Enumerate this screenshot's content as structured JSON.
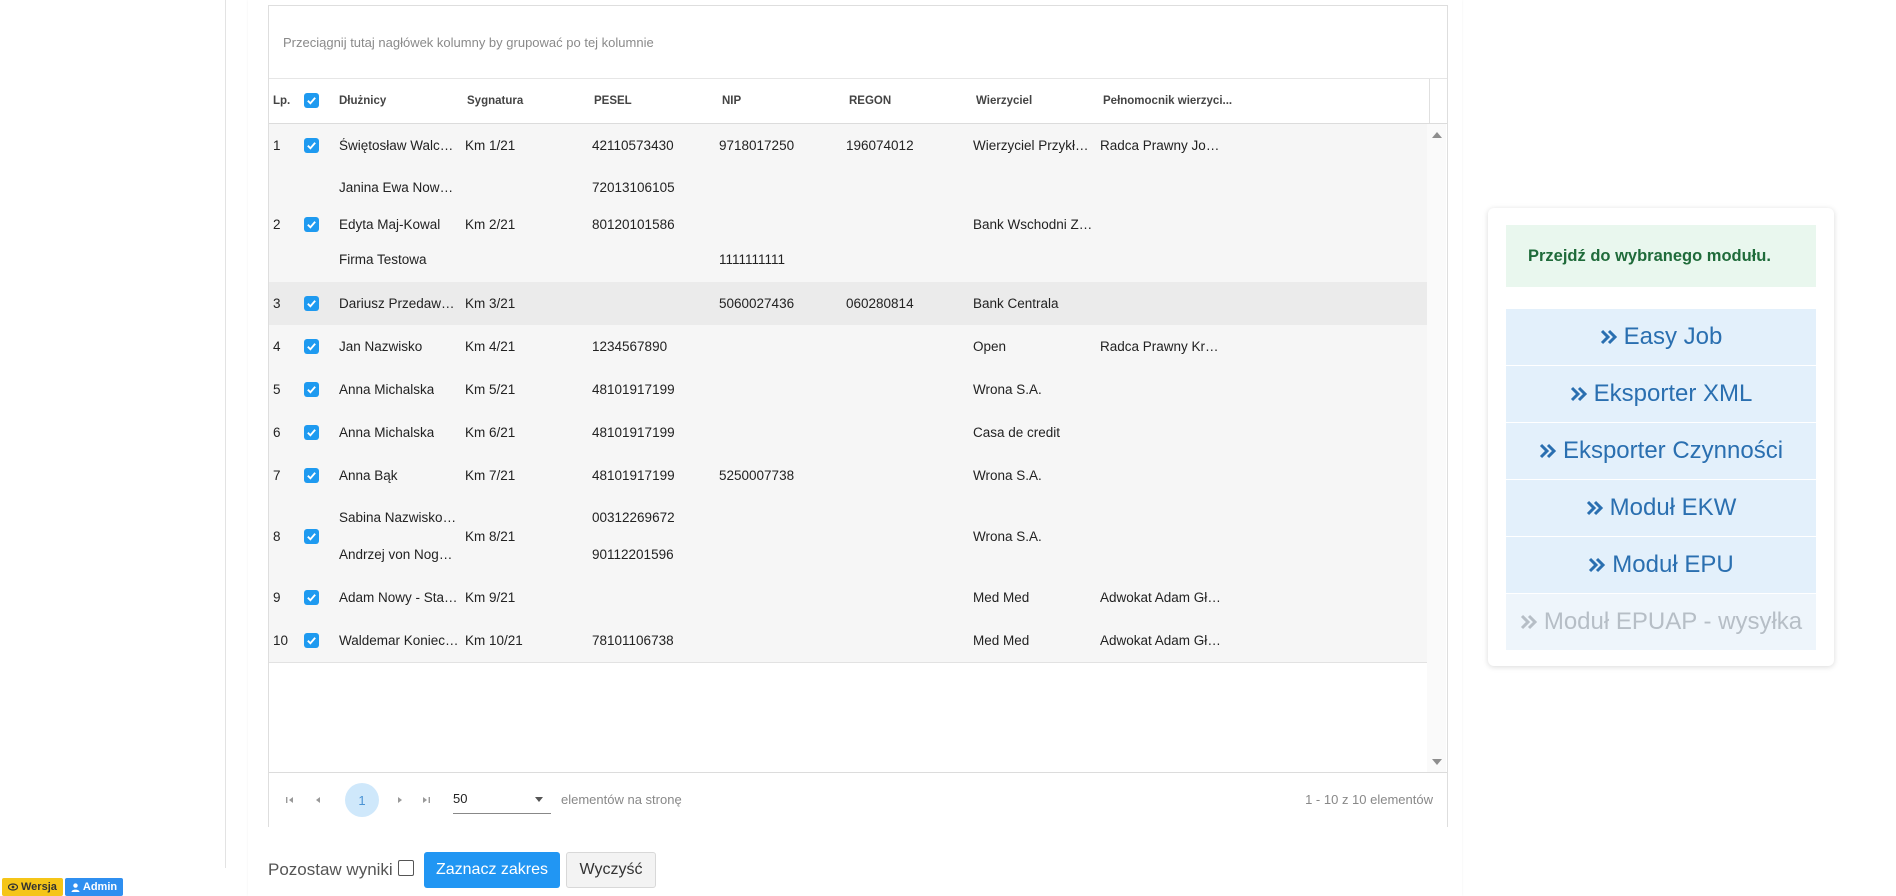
{
  "grid": {
    "group_hint": "Przeciągnij tutaj nagłówek kolumny by grupować po tej kolumnie",
    "columns": {
      "lp": "Lp.",
      "debtors": "Dłużnicy",
      "signature": "Sygnatura",
      "pesel": "PESEL",
      "nip": "NIP",
      "regon": "REGON",
      "creditor": "Wierzyciel",
      "attorney": "Pełnomocnik wierzyci..."
    },
    "rows": [
      {
        "lp": "1",
        "debtors": [
          "Świętosław Walczak"
        ],
        "signature": "Km 1/21",
        "pesel": [
          "42110573430"
        ],
        "nip": [
          "9718017250"
        ],
        "regon": "196074012",
        "creditor": "Wierzyciel Przykładow...",
        "attorney": "Radca Prawny Joann...",
        "checked": true
      },
      {
        "lp": "2",
        "debtors": [
          "Janina Ewa Nowak (d....",
          "Edyta Maj-Kowal",
          "Firma Testowa"
        ],
        "signature": "Km 2/21",
        "pesel": [
          "72013106105",
          "80120101586",
          ""
        ],
        "nip": [
          "",
          "",
          "1111111111"
        ],
        "regon": "",
        "creditor": "Bank Wschodni ZBK SA",
        "attorney": "",
        "checked": true
      },
      {
        "lp": "3",
        "debtors": [
          "Dariusz Przedawnienie"
        ],
        "signature": "Km 3/21",
        "pesel": [
          ""
        ],
        "nip": [
          "5060027436"
        ],
        "regon": "060280814",
        "creditor": "Bank Centrala",
        "attorney": "",
        "checked": true
      },
      {
        "lp": "4",
        "debtors": [
          "Jan Nazwisko"
        ],
        "signature": "Km 4/21",
        "pesel": [
          "1234567890"
        ],
        "nip": [
          ""
        ],
        "regon": "",
        "creditor": "Open",
        "attorney": "Radca Prawny Krzysz...",
        "checked": true
      },
      {
        "lp": "5",
        "debtors": [
          "Anna Michalska"
        ],
        "signature": "Km 5/21",
        "pesel": [
          "48101917199"
        ],
        "nip": [
          ""
        ],
        "regon": "",
        "creditor": "Wrona S.A.",
        "attorney": "",
        "checked": true
      },
      {
        "lp": "6",
        "debtors": [
          "Anna Michalska"
        ],
        "signature": "Km 6/21",
        "pesel": [
          "48101917199"
        ],
        "nip": [
          ""
        ],
        "regon": "",
        "creditor": "Casa de credit",
        "attorney": "",
        "checked": true
      },
      {
        "lp": "7",
        "debtors": [
          "Anna Bąk"
        ],
        "signature": "Km 7/21",
        "pesel": [
          "48101917199"
        ],
        "nip": [
          "5250007738"
        ],
        "regon": "",
        "creditor": "Wrona S.A.",
        "attorney": "",
        "checked": true
      },
      {
        "lp": "8",
        "debtors": [
          "Sabina Nazwiskowa d...",
          "Andrzej von Nogaj-Le..."
        ],
        "signature": "Km 8/21",
        "pesel": [
          "00312269672",
          "90112201596"
        ],
        "nip": [
          "",
          ""
        ],
        "regon": "",
        "creditor": "Wrona S.A.",
        "attorney": "",
        "checked": true
      },
      {
        "lp": "9",
        "debtors": [
          "Adam Nowy - Stary d. ..."
        ],
        "signature": "Km 9/21",
        "pesel": [
          ""
        ],
        "nip": [
          ""
        ],
        "regon": "",
        "creditor": "Med Med",
        "attorney": "Adwokat Adam Głowacki",
        "checked": true
      },
      {
        "lp": "10",
        "debtors": [
          "Waldemar Konieczny"
        ],
        "signature": "Km 10/21",
        "pesel": [
          "78101106738"
        ],
        "nip": [
          ""
        ],
        "regon": "",
        "creditor": "Med Med",
        "attorney": "Adwokat Adam Głowacki",
        "checked": true
      }
    ]
  },
  "pager": {
    "current_page": "1",
    "page_size": "50",
    "per_page_label": "elementów na stronę",
    "range_info": "1 - 10 z 10 elementów"
  },
  "actions": {
    "keep_results_label": "Pozostaw wyniki",
    "select_range_label": "Zaznacz zakres",
    "clear_label": "Wyczyść"
  },
  "side": {
    "header": "Przejdź do wybranego modułu.",
    "modules": [
      {
        "label": "Easy Job",
        "enabled": true
      },
      {
        "label": "Eksporter XML",
        "enabled": true
      },
      {
        "label": "Eksporter Czynności",
        "enabled": true
      },
      {
        "label": "Moduł EKW",
        "enabled": true
      },
      {
        "label": "Moduł EPU",
        "enabled": true
      },
      {
        "label": "Moduł EPUAP - wysyłka",
        "enabled": false
      }
    ]
  },
  "badges": {
    "version": "Wersja",
    "admin": "Admin"
  },
  "colors": {
    "accent": "#2196f3",
    "checkbox": "#1e9af0",
    "module_bg": "#e3f0fb",
    "module_text": "#2a6fb0",
    "header_bg": "#e9f7ee",
    "header_text": "#1f6b3a"
  }
}
